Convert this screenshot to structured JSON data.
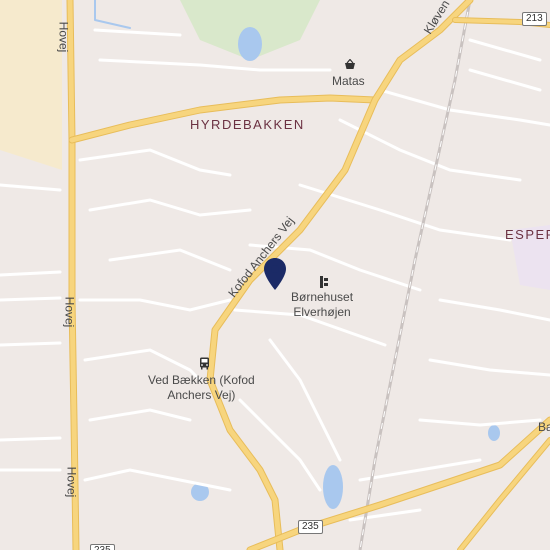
{
  "labels": {
    "hyrdebakken": "HYRDEBAKKEN",
    "espergaerde": "ESPER",
    "matas": "Matas",
    "boernehuset_line1": "Børnehuset",
    "boernehuset_line2": "Elverhøjen",
    "ved_baekken_line1": "Ved Bækken (Kofod",
    "ved_baekken_line2": "Anchers Vej)",
    "kofod_anchers_vej": "Kofod Anchers Vej",
    "hovej_top": "Hovej",
    "hovej_mid": "Hovej",
    "hovej_bottom": "Hovej",
    "kloeven": "Kløven",
    "edge_ba": "Ba"
  },
  "route_shields": {
    "r213": "213",
    "r235": "235",
    "r_bottom_left": "235"
  },
  "icons": {
    "shop": "shopping-basket-icon",
    "school": "school-icon",
    "bus": "bus-stop-icon",
    "pin": "map-pin-icon"
  },
  "colors": {
    "background": "#efe9e6",
    "road_major": "#f7d57e",
    "road_major_edge": "#e8bd5a",
    "road_minor": "#ffffff",
    "water": "#a9c8ee",
    "park": "#d6e5c6",
    "built": "#f6eacd",
    "pin": "#1b2a66",
    "area_label": "#6b3142"
  }
}
